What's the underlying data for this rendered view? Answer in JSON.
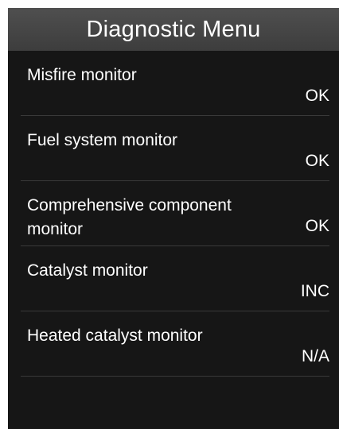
{
  "header": {
    "title": "Diagnostic Menu"
  },
  "monitors": [
    {
      "label": "Misfire monitor",
      "status": "OK"
    },
    {
      "label": "Fuel system monitor",
      "status": "OK"
    },
    {
      "label": "Comprehensive component\nmonitor",
      "status": "OK"
    },
    {
      "label": "Catalyst monitor",
      "status": "INC"
    },
    {
      "label": "Heated catalyst monitor",
      "status": "N/A"
    }
  ]
}
